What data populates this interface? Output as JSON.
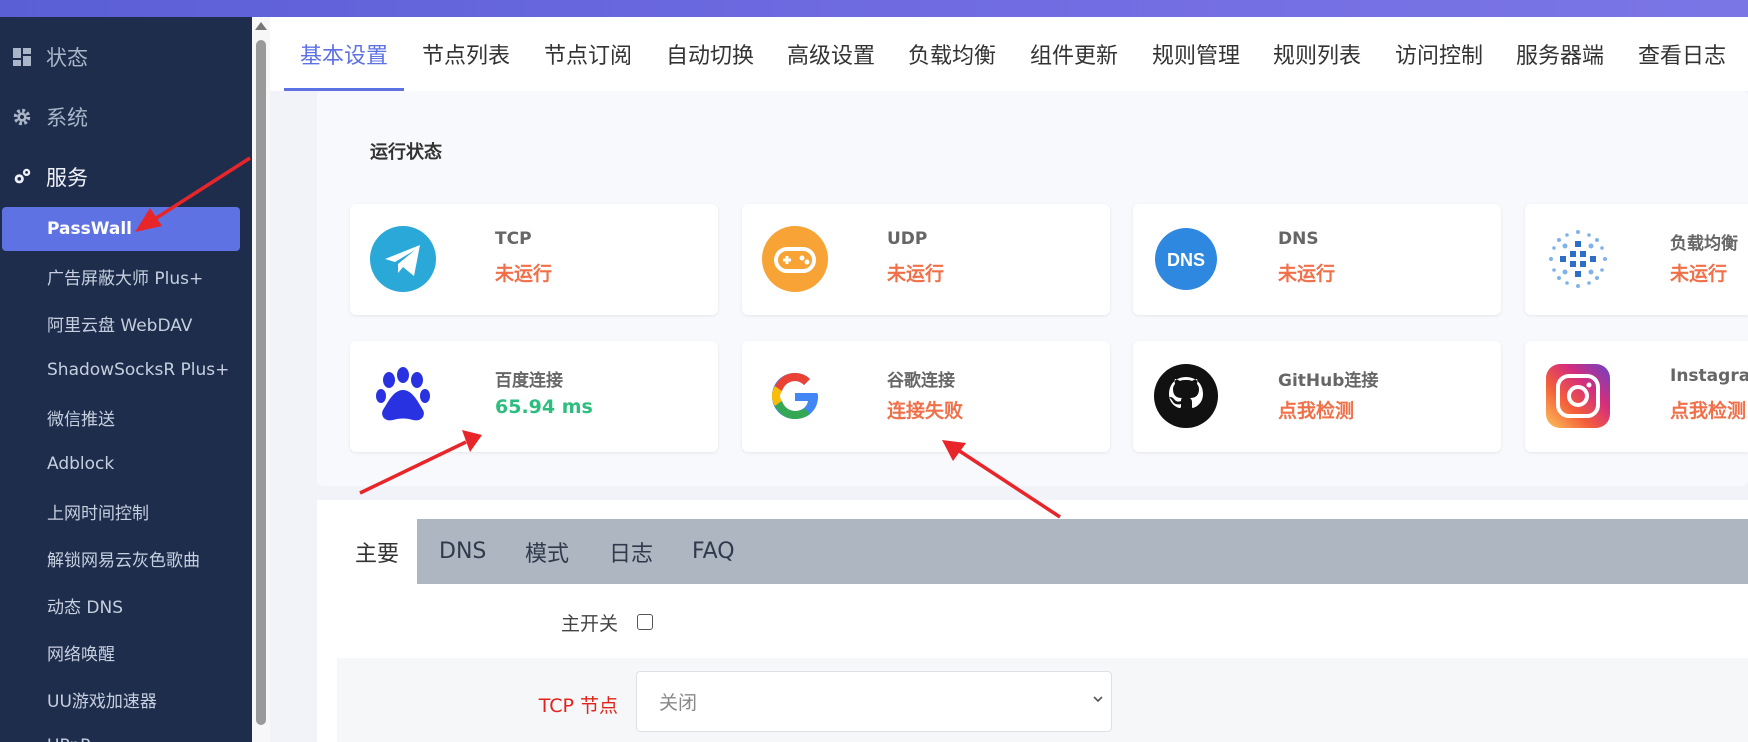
{
  "colors": {
    "accent": "#5e72e4",
    "sidebar_bg": "#1f2d4d",
    "status_orange": "#f0704a",
    "status_green": "#2dbd7e",
    "required_red": "#e0241b",
    "annotation_arrow": "#e8262a"
  },
  "sidebar": {
    "groups": [
      {
        "label": "状态",
        "icon": "dashboard-icon"
      },
      {
        "label": "系统",
        "icon": "gear-icon"
      },
      {
        "label": "服务",
        "icon": "gears-icon"
      }
    ],
    "items": [
      {
        "label": "PassWall",
        "active": true
      },
      {
        "label": "广告屏蔽大师 Plus+"
      },
      {
        "label": "阿里云盘 WebDAV"
      },
      {
        "label": "ShadowSocksR Plus+"
      },
      {
        "label": "微信推送"
      },
      {
        "label": "Adblock"
      },
      {
        "label": "上网时间控制"
      },
      {
        "label": "解锁网易云灰色歌曲"
      },
      {
        "label": "动态 DNS"
      },
      {
        "label": "网络唤醒"
      },
      {
        "label": "UU游戏加速器"
      },
      {
        "label": "UPnP"
      }
    ]
  },
  "tabs": [
    {
      "label": "基本设置",
      "active": true
    },
    {
      "label": "节点列表"
    },
    {
      "label": "节点订阅"
    },
    {
      "label": "自动切换"
    },
    {
      "label": "高级设置"
    },
    {
      "label": "负载均衡"
    },
    {
      "label": "组件更新"
    },
    {
      "label": "规则管理"
    },
    {
      "label": "规则列表"
    },
    {
      "label": "访问控制"
    },
    {
      "label": "服务器端"
    },
    {
      "label": "查看日志"
    }
  ],
  "status_section": {
    "title": "运行状态",
    "cards": [
      {
        "name": "TCP",
        "status": "未运行",
        "icon": "telegram-icon"
      },
      {
        "name": "UDP",
        "status": "未运行",
        "icon": "gamepad-icon"
      },
      {
        "name": "DNS",
        "status": "未运行",
        "icon": "dns-icon",
        "icon_text": "DNS"
      },
      {
        "name": "负载均衡",
        "status": "未运行",
        "icon": "load-balance-icon"
      },
      {
        "name": "百度连接",
        "status": "65.94 ms",
        "icon": "baidu-paw-icon"
      },
      {
        "name": "谷歌连接",
        "status": "连接失败",
        "icon": "google-icon",
        "icon_text": "G"
      },
      {
        "name": "GitHub连接",
        "status": "点我检测",
        "icon": "github-icon"
      },
      {
        "name": "Instagram",
        "status": "点我检测",
        "icon": "instagram-icon"
      }
    ]
  },
  "subtabs": [
    {
      "label": "主要",
      "active": true
    },
    {
      "label": "DNS"
    },
    {
      "label": "模式"
    },
    {
      "label": "日志"
    },
    {
      "label": "FAQ"
    }
  ],
  "form": {
    "main_switch_label": "主开关",
    "main_switch_checked": false,
    "tcp_node_label": "TCP 节点",
    "tcp_node_value": "关闭"
  }
}
